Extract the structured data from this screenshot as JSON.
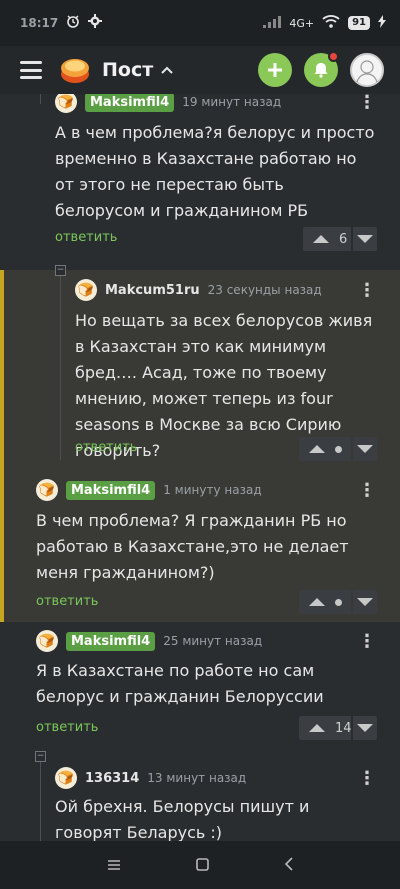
{
  "status_bar": {
    "time": "18:17",
    "network_label": "4G+",
    "battery": "91"
  },
  "app_bar": {
    "title": "Пост"
  },
  "comments": [
    {
      "author": "Maksimfil4",
      "time": "19 минут назад",
      "text": "А в чем проблема?я белорус и просто временно в Казахстане работаю но от этого не перестаю быть белорусом и гражданином РБ",
      "reply_label": "ответить",
      "score": "6"
    },
    {
      "author": "Makcum51ru",
      "time": "23 секунды назад",
      "text": "Но вещать за всех белорусов живя в Казахстан это как минимум бред…. Асад, тоже по твоему мнению, может теперь из four seasons в Москве за всю Сирию говорить?",
      "reply_label": "ответить"
    },
    {
      "author": "Maksimfil4",
      "time": "1 минуту назад",
      "text": "В чем проблема? Я гражданин РБ но работаю в Казахстане,это не делает меня гражданином?)",
      "reply_label": "ответить"
    },
    {
      "author": "Maksimfil4",
      "time": "25 минут назад",
      "text": "Я в Казахстане по работе но сам белорус и гражданин Белоруссии",
      "reply_label": "ответить",
      "score": "14"
    },
    {
      "author": "136314",
      "time": "13 минут назад",
      "text": "Ой брехня. Белорусы пишут и говорят Беларусь :)"
    }
  ],
  "colors": {
    "accent_green": "#8ac858",
    "badge_green": "#5b9f44",
    "reply_green": "#7bc65a",
    "highlight_bar": "#c6a51f",
    "notification_dot": "#e8453c"
  },
  "icons": [
    "alarm-icon",
    "settings-icon",
    "signal-icon",
    "wifi-icon",
    "bolt-icon",
    "hamburger-icon",
    "logo-icon",
    "chevron-up-icon",
    "plus-icon",
    "bell-icon",
    "kebab-icon",
    "upvote-icon",
    "downvote-icon",
    "collapse-icon",
    "nav-menu-icon",
    "nav-home-icon",
    "nav-back-icon"
  ]
}
